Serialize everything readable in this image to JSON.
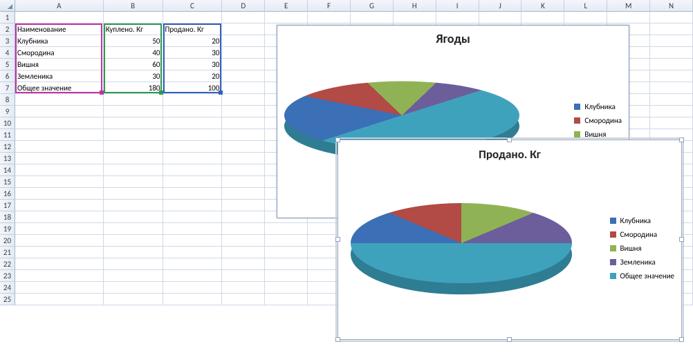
{
  "columns": [
    "A",
    "B",
    "C",
    "D",
    "E",
    "F",
    "G",
    "H",
    "I",
    "J",
    "K",
    "L",
    "M",
    "N"
  ],
  "row_count": 25,
  "table": {
    "header": {
      "name": "Наименование",
      "bought": "Куплено. Кг",
      "sold": "Продано. Кг"
    },
    "rows": [
      {
        "name": "Клубника",
        "bought": 50,
        "sold": 20
      },
      {
        "name": "Смородина",
        "bought": 40,
        "sold": 30
      },
      {
        "name": "Вишня",
        "bought": 60,
        "sold": 30
      },
      {
        "name": "Земленика",
        "bought": 30,
        "sold": 20
      }
    ],
    "total_label": "Общее значение",
    "total_bought": 180,
    "total_sold": 100
  },
  "chart1": {
    "title": "Ягоды",
    "legend": [
      "Клубника",
      "Смородина",
      "Вишня"
    ]
  },
  "chart2": {
    "title": "Продано. Кг",
    "legend": [
      "Клубника",
      "Смородина",
      "Вишня",
      "Земленика",
      "Общее значение"
    ]
  },
  "chart_data": [
    {
      "type": "pie",
      "title": "Ягоды",
      "series": [
        {
          "name": "Клубника",
          "value": 50
        },
        {
          "name": "Смородина",
          "value": 40
        },
        {
          "name": "Вишня",
          "value": 60
        },
        {
          "name": "Земленика",
          "value": 30
        },
        {
          "name": "Общее значение",
          "value": 180
        }
      ],
      "legend": [
        "Клубника",
        "Смородина",
        "Вишня"
      ],
      "note": "Legend partially obscured by overlapping second chart; only first three entries visible in screenshot."
    },
    {
      "type": "pie",
      "title": "Продано. Кг",
      "series": [
        {
          "name": "Клубника",
          "value": 20
        },
        {
          "name": "Смородина",
          "value": 30
        },
        {
          "name": "Вишня",
          "value": 30
        },
        {
          "name": "Земленика",
          "value": 20
        },
        {
          "name": "Общее значение",
          "value": 100
        }
      ],
      "legend": [
        "Клубника",
        "Смородина",
        "Вишня",
        "Земленика",
        "Общее значение"
      ]
    }
  ],
  "colors": {
    "Клубника": "#3b6fb6",
    "Смородина": "#b24a46",
    "Вишня": "#8fb354",
    "Земленика": "#6c5e9b",
    "Общее значение": "#3fa2bd"
  }
}
